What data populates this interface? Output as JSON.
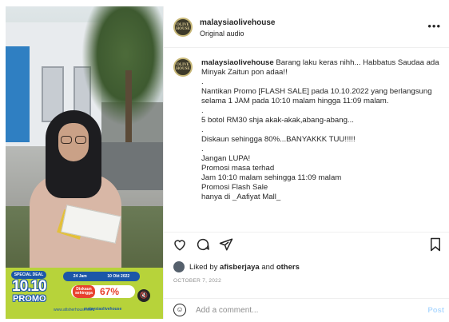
{
  "media": {
    "promo": {
      "special": "SPECIAL DEAL",
      "big": "10.10",
      "promo_word": "PROMO",
      "duration": "24 Jam",
      "date": "10 Okt 2022",
      "discount_tag": "Diskaun sehingga",
      "discount_value": "67%",
      "website": "www.afisherhouse.com",
      "social_handle": "malaysiaolivehouse",
      "mute_icon": "speaker-muted-icon"
    }
  },
  "header": {
    "avatar_text": "OLIVE HOUSE",
    "username": "malaysiaolivehouse",
    "audio": "Original audio",
    "more": "•••"
  },
  "caption": {
    "username": "malaysiaolivehouse",
    "first_line": " Barang laku keras nihh... Habbatus Saudaa ada Minyak Zaitun pon adaa!!",
    "lines": [
      ".",
      "Nantikan Promo [FLASH SALE] pada 10.10.2022 yang berlangsung selama 1 JAM pada 10:10 malam hingga 11:09 malam.",
      ".",
      "5 botol RM30 shja akak-akak,abang-abang...",
      ".",
      "Diskaun sehingga 80%...BANYAKKK TUU!!!!!",
      ".",
      "Jangan LUPA!",
      "Promosi masa terhad",
      "Jam 10:10 malam sehingga 11:09 malam",
      "Promosi Flash Sale",
      "hanya di _Aafiyat Mall_"
    ]
  },
  "actions": {
    "icons": [
      "heart-icon",
      "comment-icon",
      "share-icon",
      "bookmark-icon"
    ]
  },
  "likes": {
    "prefix": "Liked by ",
    "user": "afisberjaya",
    "middle": " and ",
    "others": "others"
  },
  "date": "OCTOBER 7, 2022",
  "comment": {
    "placeholder": "Add a comment...",
    "post_label": "Post"
  },
  "colors": {
    "brand_blue": "#1c57a8",
    "promo_green": "#b7d33a",
    "promo_red": "#e8412d",
    "post_disabled": "#b3dbff"
  }
}
